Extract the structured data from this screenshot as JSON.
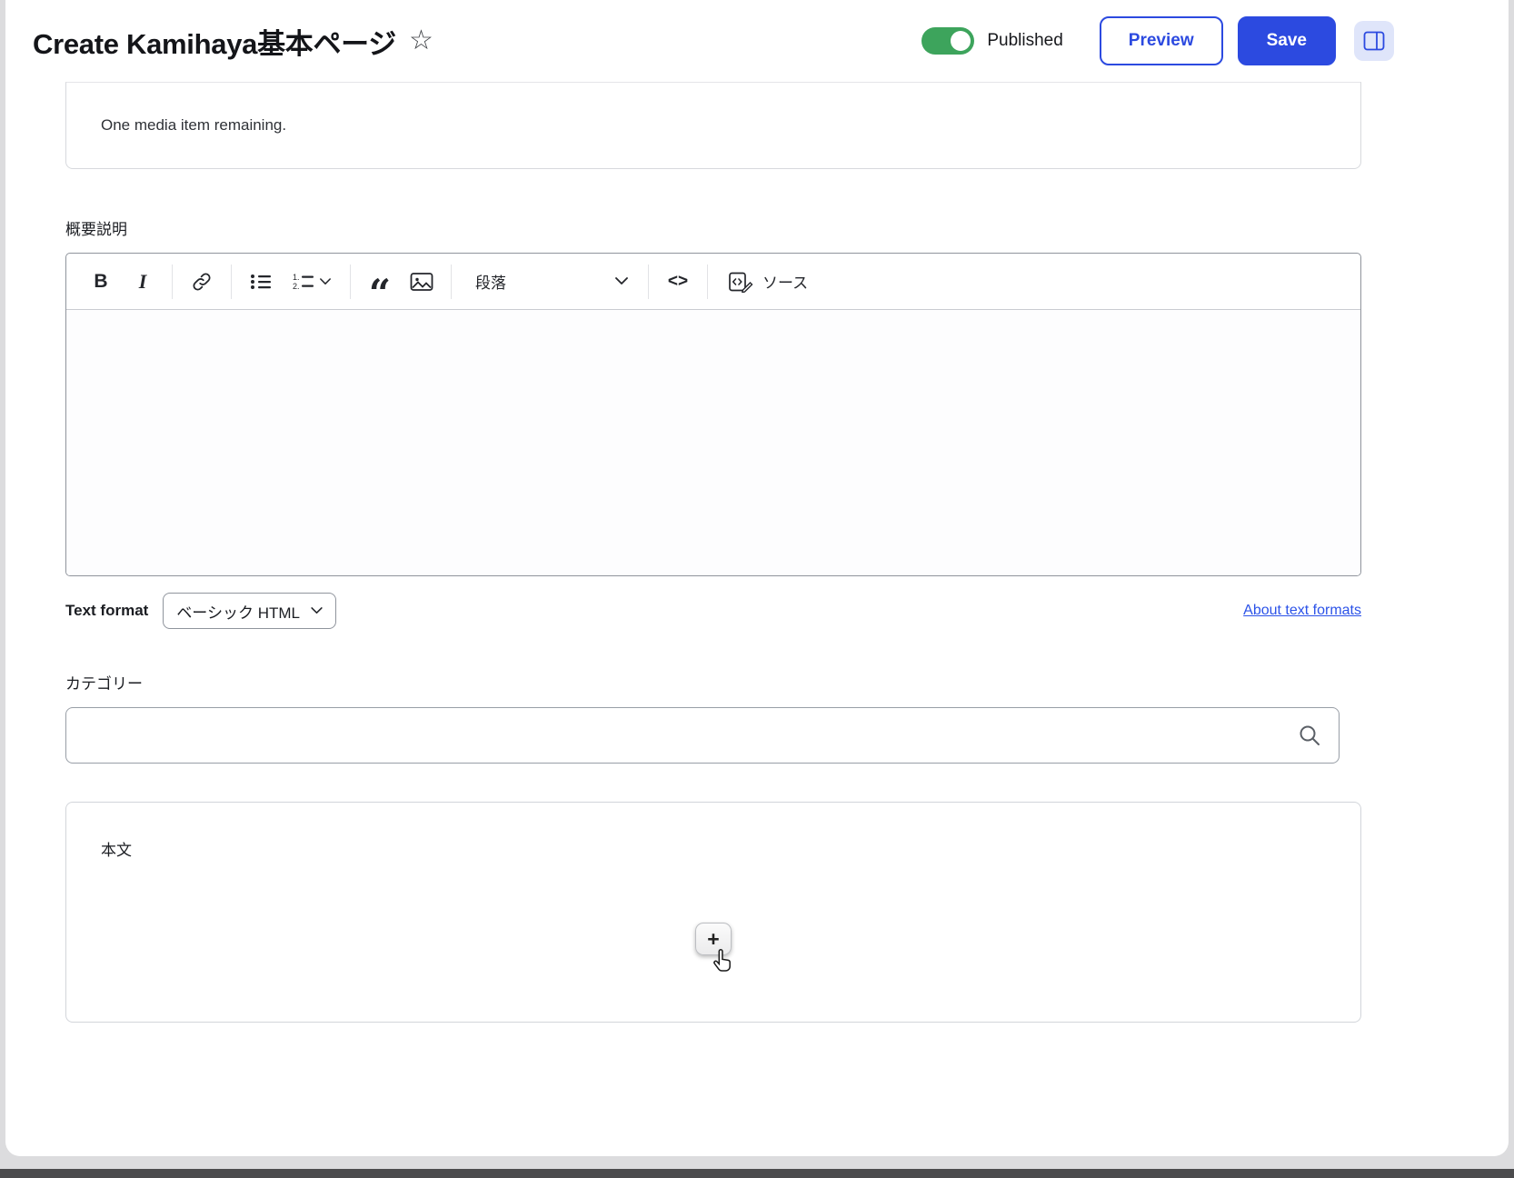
{
  "header": {
    "title": "Create Kamihaya基本ページ",
    "star_icon": "☆",
    "published_label": "Published",
    "preview_label": "Preview",
    "save_label": "Save"
  },
  "media_widget": {
    "remaining_text": "One media item remaining."
  },
  "summary_field": {
    "label": "概要説明",
    "toolbar": {
      "bold_label": "B",
      "italic_label": "I",
      "blockquote_glyph": "“",
      "paragraph_dropdown_label": "段落",
      "code_label": "<>",
      "source_label": "ソース"
    },
    "editor_content": ""
  },
  "text_format": {
    "label": "Text format",
    "selected_value": "ベーシック HTML",
    "about_link_label": "About text formats"
  },
  "category_field": {
    "label": "カテゴリー",
    "search_value": ""
  },
  "body_field": {
    "label": "本文",
    "add_button_label": "+"
  },
  "colors": {
    "primary_blue": "#2c4ae0",
    "toggle_green": "#3da45c",
    "link_blue": "#2b52e8",
    "bottom_bar_gray": "#4b4b4d"
  }
}
